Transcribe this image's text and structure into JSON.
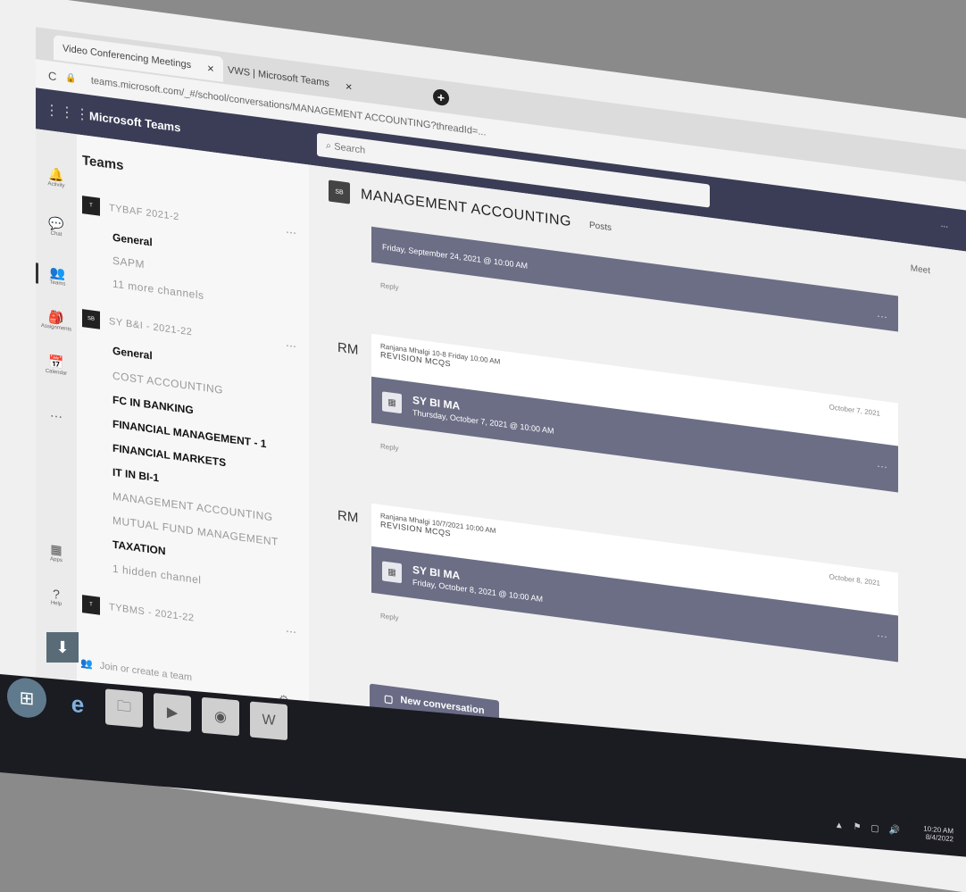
{
  "browser": {
    "tabs": [
      {
        "label": "Video Conferencing Meetings",
        "close": "×"
      },
      {
        "label": "VWS | Microsoft Teams",
        "close": "×"
      }
    ],
    "new_tab": "+",
    "reload": "C",
    "url": "teams.microsoft.com/_#/school/conversations/MANAGEMENT ACCOUNTING?threadId=..."
  },
  "teams_bar": {
    "waffle": "⋮⋮⋮",
    "brand": "Microsoft Teams",
    "search_placeholder": "Search",
    "profile": "..."
  },
  "rail": [
    {
      "icon": "🔔",
      "label": "Activity"
    },
    {
      "icon": "💬",
      "label": "Chat"
    },
    {
      "icon": "👥",
      "label": "Teams"
    },
    {
      "icon": "🎒",
      "label": "Assignments"
    },
    {
      "icon": "📅",
      "label": "Calendar"
    },
    {
      "icon": "···",
      "label": ""
    },
    {
      "icon": "▦",
      "label": "Apps"
    },
    {
      "icon": "?",
      "label": "Help"
    }
  ],
  "download_icon": "⬇",
  "panel": {
    "title": "Teams",
    "teams": [
      {
        "avatar": "T",
        "name": "TYBAF 2021-2",
        "more": "···",
        "channels": [
          {
            "label": "General",
            "style": "bold"
          },
          {
            "label": "SAPM",
            "style": "dim"
          },
          {
            "label": "11 more channels",
            "style": "dim"
          }
        ]
      },
      {
        "avatar": "SB",
        "name": "SY B&I - 2021-22",
        "more": "···",
        "channels": [
          {
            "label": "General",
            "style": "bold"
          },
          {
            "label": "COST ACCOUNTING",
            "style": "dim"
          },
          {
            "label": "FC IN BANKING",
            "style": "bold"
          },
          {
            "label": "FINANCIAL MANAGEMENT - 1",
            "style": "bold"
          },
          {
            "label": "FINANCIAL MARKETS",
            "style": "bold"
          },
          {
            "label": "IT IN BI-1",
            "style": "bold"
          },
          {
            "label": "MANAGEMENT ACCOUNTING",
            "style": "dim"
          },
          {
            "label": "MUTUAL FUND MANAGEMENT",
            "style": "dim"
          },
          {
            "label": "TAXATION",
            "style": "bold"
          },
          {
            "label": "1 hidden channel",
            "style": "dim"
          }
        ]
      },
      {
        "avatar": "T",
        "name": "TYBMS - 2021-22",
        "more": "···",
        "channels": []
      }
    ],
    "join": "Join or create a team",
    "join_icon": "👥",
    "gear_icon": "⚙"
  },
  "main": {
    "channel_avatar": "SB",
    "channel_title": "MANAGEMENT ACCOUNTING",
    "channel_tab": "Posts",
    "header_right": "Meet",
    "posts": [
      {
        "meeting_title": "",
        "meeting_time": "Friday, September 24, 2021 @ 10:00 AM",
        "reply": "Reply",
        "right_label": "Meet"
      },
      {
        "initials": "RM",
        "author": "Ranjana Mhalgi 10-8 Friday 10:00 AM",
        "subject": "REVISION MCQS",
        "ts": "October 7, 2021",
        "meeting_title": "SY BI MA",
        "meeting_time": "Thursday, October 7, 2021 @ 10:00 AM",
        "reply": "Reply"
      },
      {
        "initials": "RM",
        "author": "Ranjana Mhalgi 10/7/2021 10:00 AM",
        "subject": "REVISION MCQS",
        "ts": "October 8, 2021",
        "meeting_title": "SY BI MA",
        "meeting_time": "Friday, October 8, 2021 @ 10:00 AM",
        "reply": "Reply"
      }
    ],
    "new_conversation": "New conversation"
  },
  "taskbar": {
    "start_icon": "⊞",
    "ie_icon": "e",
    "apps": [
      "🗀",
      "▶",
      "◉",
      "W"
    ],
    "tray_icons": "▲ ⚑ ▢ 🔊",
    "time": "10:20 AM",
    "date": "8/4/2022"
  }
}
